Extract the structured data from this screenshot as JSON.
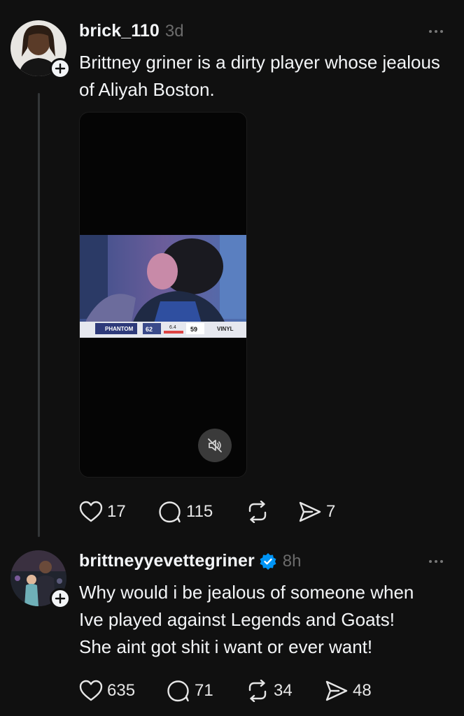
{
  "post1": {
    "username": "brick_110",
    "time": "3d",
    "text": "Brittney griner is a dirty player whose jealous of Aliyah Boston.",
    "video": {
      "scoreboard": {
        "team_left": "PHANTOM",
        "score_left": "62",
        "clock": "6.4",
        "score_right": "59",
        "team_right": "VINYL"
      }
    },
    "likes": "17",
    "replies": "115",
    "reposts": "",
    "shares": "7"
  },
  "post2": {
    "username": "brittneyyevettegriner",
    "verified": true,
    "time": "8h",
    "text_lines": [
      "Why would i be jealous of someone when",
      "Ive played against Legends and Goats!",
      "She aint got shit i want or ever want!"
    ],
    "likes": "635",
    "replies": "71",
    "reposts": "34",
    "shares": "48"
  },
  "colors": {
    "background": "#101010",
    "text": "#f3f5f7",
    "muted": "#6b6b6b",
    "verified": "#0095f6"
  }
}
